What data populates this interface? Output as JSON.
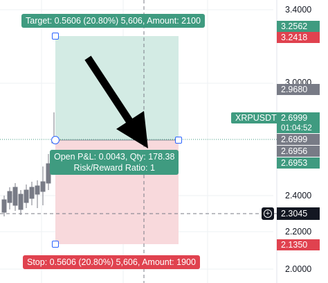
{
  "symbol": "XRPUSDT",
  "countdown": "01:04:52",
  "price_axis": [
    "3.4000",
    "3.0000",
    "2.4000",
    "2.2000",
    "2.0000"
  ],
  "price_tags": [
    {
      "value": "3.2562",
      "color": "green"
    },
    {
      "value": "3.2418",
      "color": "red"
    },
    {
      "value": "2.9680",
      "color": "gray"
    },
    {
      "value": "2.6999",
      "color": "green"
    },
    {
      "value": "2.6999",
      "color": "gray"
    },
    {
      "value": "2.6956",
      "color": "gray"
    },
    {
      "value": "2.6953",
      "color": "green"
    },
    {
      "value": "2.1350",
      "color": "red"
    }
  ],
  "crosshair_price": "2.3045",
  "crosshair_plus": "+",
  "target_label": "Target: 0.5606 (20.80%) 5,606, Amount: 2100",
  "stop_label": "Stop: 0.5606 (20.80%) 5,606, Amount: 1900",
  "pnl_label": {
    "line1": "Open P&L: 0.0043, Qty: 178.38",
    "line2": "Risk/Reward Ratio: 1"
  },
  "colors": {
    "profit_zone": "#d3ebe4",
    "loss_zone": "#f8d9dc",
    "green": "#3f9b80",
    "red": "#e0424f",
    "candle": "#787b86"
  }
}
